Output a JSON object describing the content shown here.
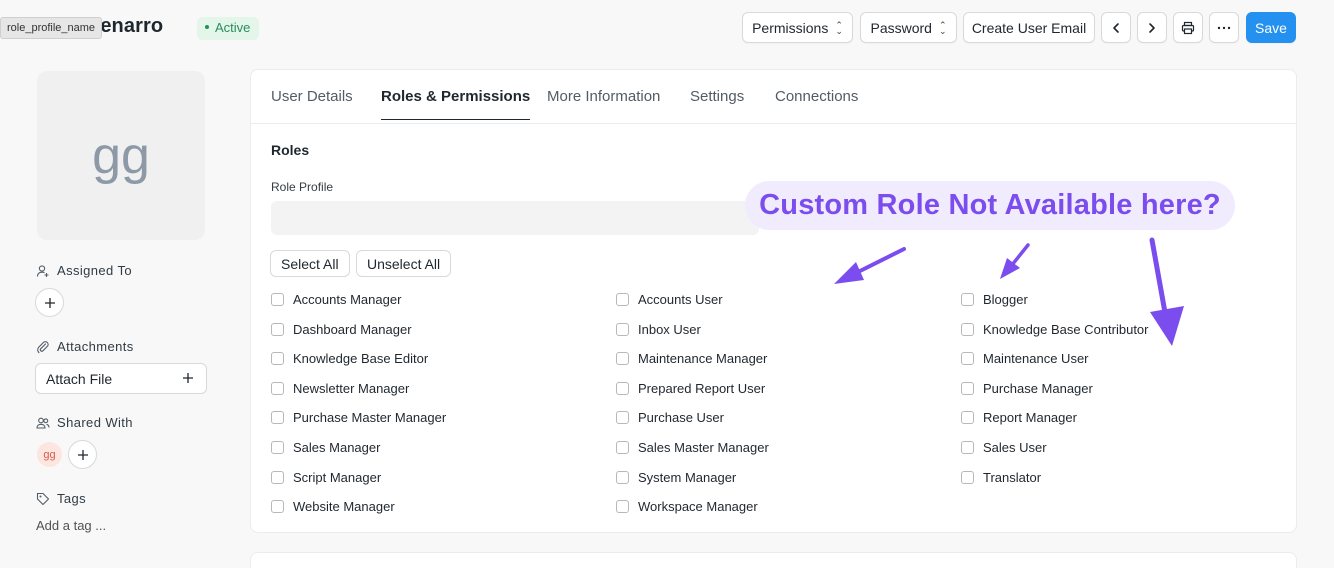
{
  "header": {
    "title": "genarro",
    "tooltip": "role_profile_name",
    "status": "Active",
    "buttons": {
      "permissions": "Permissions",
      "password": "Password",
      "create_email": "Create User Email",
      "save": "Save"
    }
  },
  "sidebar": {
    "avatar_initials": "gg",
    "assigned_to": "Assigned To",
    "attachments": "Attachments",
    "attach_file": "Attach File",
    "shared_with": "Shared With",
    "shared_avatar": "gg",
    "tags": "Tags",
    "add_tag": "Add a tag ..."
  },
  "tabs": [
    "User Details",
    "Roles & Permissions",
    "More Information",
    "Settings",
    "Connections"
  ],
  "active_tab": "Roles & Permissions",
  "roles_section": {
    "title": "Roles",
    "role_profile_label": "Role Profile",
    "role_profile_value": "",
    "select_all": "Select All",
    "unselect_all": "Unselect All",
    "columns": [
      [
        "Accounts Manager",
        "Dashboard Manager",
        "Knowledge Base Editor",
        "Newsletter Manager",
        "Purchase Master Manager",
        "Sales Manager",
        "Script Manager",
        "Website Manager"
      ],
      [
        "Accounts User",
        "Inbox User",
        "Maintenance Manager",
        "Prepared Report User",
        "Purchase User",
        "Sales Master Manager",
        "System Manager",
        "Workspace Manager"
      ],
      [
        "Blogger",
        "Knowledge Base Contributor",
        "Maintenance User",
        "Purchase Manager",
        "Report Manager",
        "Sales User",
        "Translator"
      ]
    ]
  },
  "annotation": {
    "text": "Custom Role Not Available here?",
    "color": "#7c4dee"
  },
  "colors": {
    "primary": "#2490ef",
    "status_green": "#278f5e"
  }
}
